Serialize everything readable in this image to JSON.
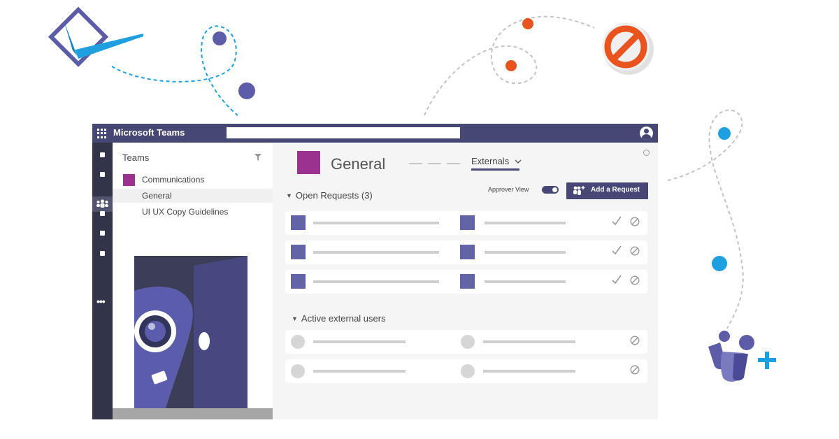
{
  "window": {
    "app_title": "Microsoft Teams",
    "search": {
      "value": "",
      "placeholder": ""
    }
  },
  "rail": {
    "more_label": "•••"
  },
  "sidebar": {
    "heading": "Teams",
    "team": {
      "name": "Communications",
      "color": "#9b3292"
    },
    "channels": [
      "General",
      "UI UX Copy Guidelines"
    ]
  },
  "channel": {
    "title": "General",
    "color": "#9b3292",
    "active_tab": "Externals"
  },
  "open_requests": {
    "heading": "Open Requests (3)",
    "approver_view_label": "Approver View",
    "approver_view_on": true,
    "add_button_label": "Add a Request",
    "row_count": 3
  },
  "active_users": {
    "heading": "Active external users",
    "row_count": 2
  },
  "colors": {
    "titlebar": "#464775",
    "rail": "#33344a",
    "accent": "#6264a7",
    "team_purple": "#9b3292",
    "decor_orange": "#e8531e",
    "decor_blue": "#1ea0e0"
  }
}
